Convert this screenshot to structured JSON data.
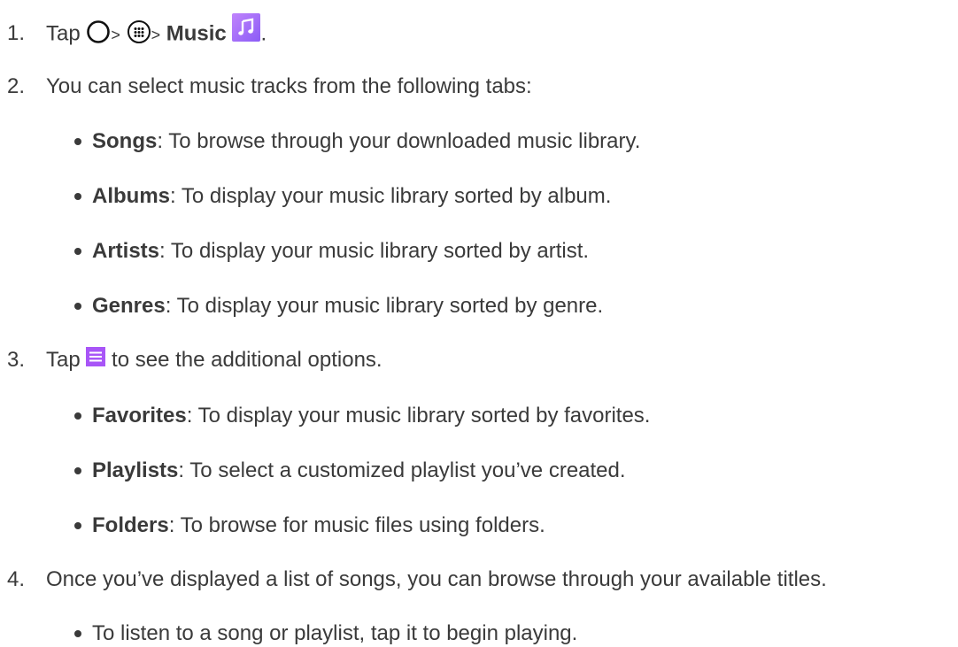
{
  "colors": {
    "text": "#3a3a3a",
    "icon_purple": "#a855f7",
    "icon_purple_dark": "#7c3aed"
  },
  "steps": [
    {
      "number": "1.",
      "parts": {
        "tap": "Tap",
        "sep1": ">",
        "sep2": ">",
        "app": "Music",
        "end": "."
      },
      "icons": [
        "home-icon",
        "apps-icon",
        "music-app-icon"
      ]
    },
    {
      "number": "2.",
      "text": "You can select music tracks from the following tabs:",
      "bullets": [
        {
          "term": "Songs",
          "desc": ": To browse through your downloaded music library."
        },
        {
          "term": "Albums",
          "desc": ": To display your music library sorted by album."
        },
        {
          "term": "Artists",
          "desc": ": To display your music library sorted by artist."
        },
        {
          "term": "Genres",
          "desc": ": To display your music library sorted by genre."
        }
      ]
    },
    {
      "number": "3.",
      "parts": {
        "tap": "Tap",
        "rest": "to see the additional options."
      },
      "icons": [
        "menu-icon"
      ],
      "bullets": [
        {
          "term": "Favorites",
          "desc": ": To display your music library sorted by favorites."
        },
        {
          "term": "Playlists",
          "desc": ": To select a customized playlist you’ve created."
        },
        {
          "term": "Folders",
          "desc": ": To browse for music files using folders."
        }
      ]
    },
    {
      "number": "4.",
      "text": "Once you’ve displayed a list of songs, you can browse through your available titles.",
      "bullets": [
        {
          "text": "To listen to a song or playlist, tap it to begin playing."
        }
      ]
    }
  ]
}
